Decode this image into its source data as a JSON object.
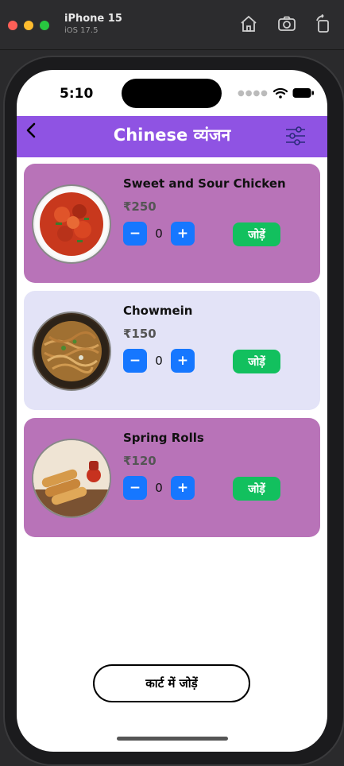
{
  "window": {
    "title": "iPhone 15",
    "subtitle": "iOS 17.5",
    "icons": [
      "home-icon",
      "screenshot-icon",
      "rotate-icon"
    ]
  },
  "status_bar": {
    "time": "5:10",
    "icons": [
      "signal-icon",
      "wifi-icon",
      "battery-icon"
    ]
  },
  "header": {
    "title": "Chinese व्यंजन",
    "background": "#8f53e3",
    "icons": [
      "back-chevron-icon",
      "filter-sliders-icon"
    ]
  },
  "menu": {
    "items": [
      {
        "name": "Sweet and Sour Chicken",
        "price": "₹250",
        "quantity": "0",
        "minus": "−",
        "plus": "+",
        "add_label": "जोड़ें",
        "card_color": "#b873b8"
      },
      {
        "name": "Chowmein",
        "price": "₹150",
        "quantity": "0",
        "minus": "−",
        "plus": "+",
        "add_label": "जोड़ें",
        "card_color": "#e3e3f7"
      },
      {
        "name": "Spring Rolls",
        "price": "₹120",
        "quantity": "0",
        "minus": "−",
        "plus": "+",
        "add_label": "जोड़ें",
        "card_color": "#b873b8"
      }
    ]
  },
  "cart": {
    "label": "कार्ट में जोड़ें"
  },
  "colors": {
    "accent": "#1677ff",
    "add_button": "#12c05e"
  }
}
